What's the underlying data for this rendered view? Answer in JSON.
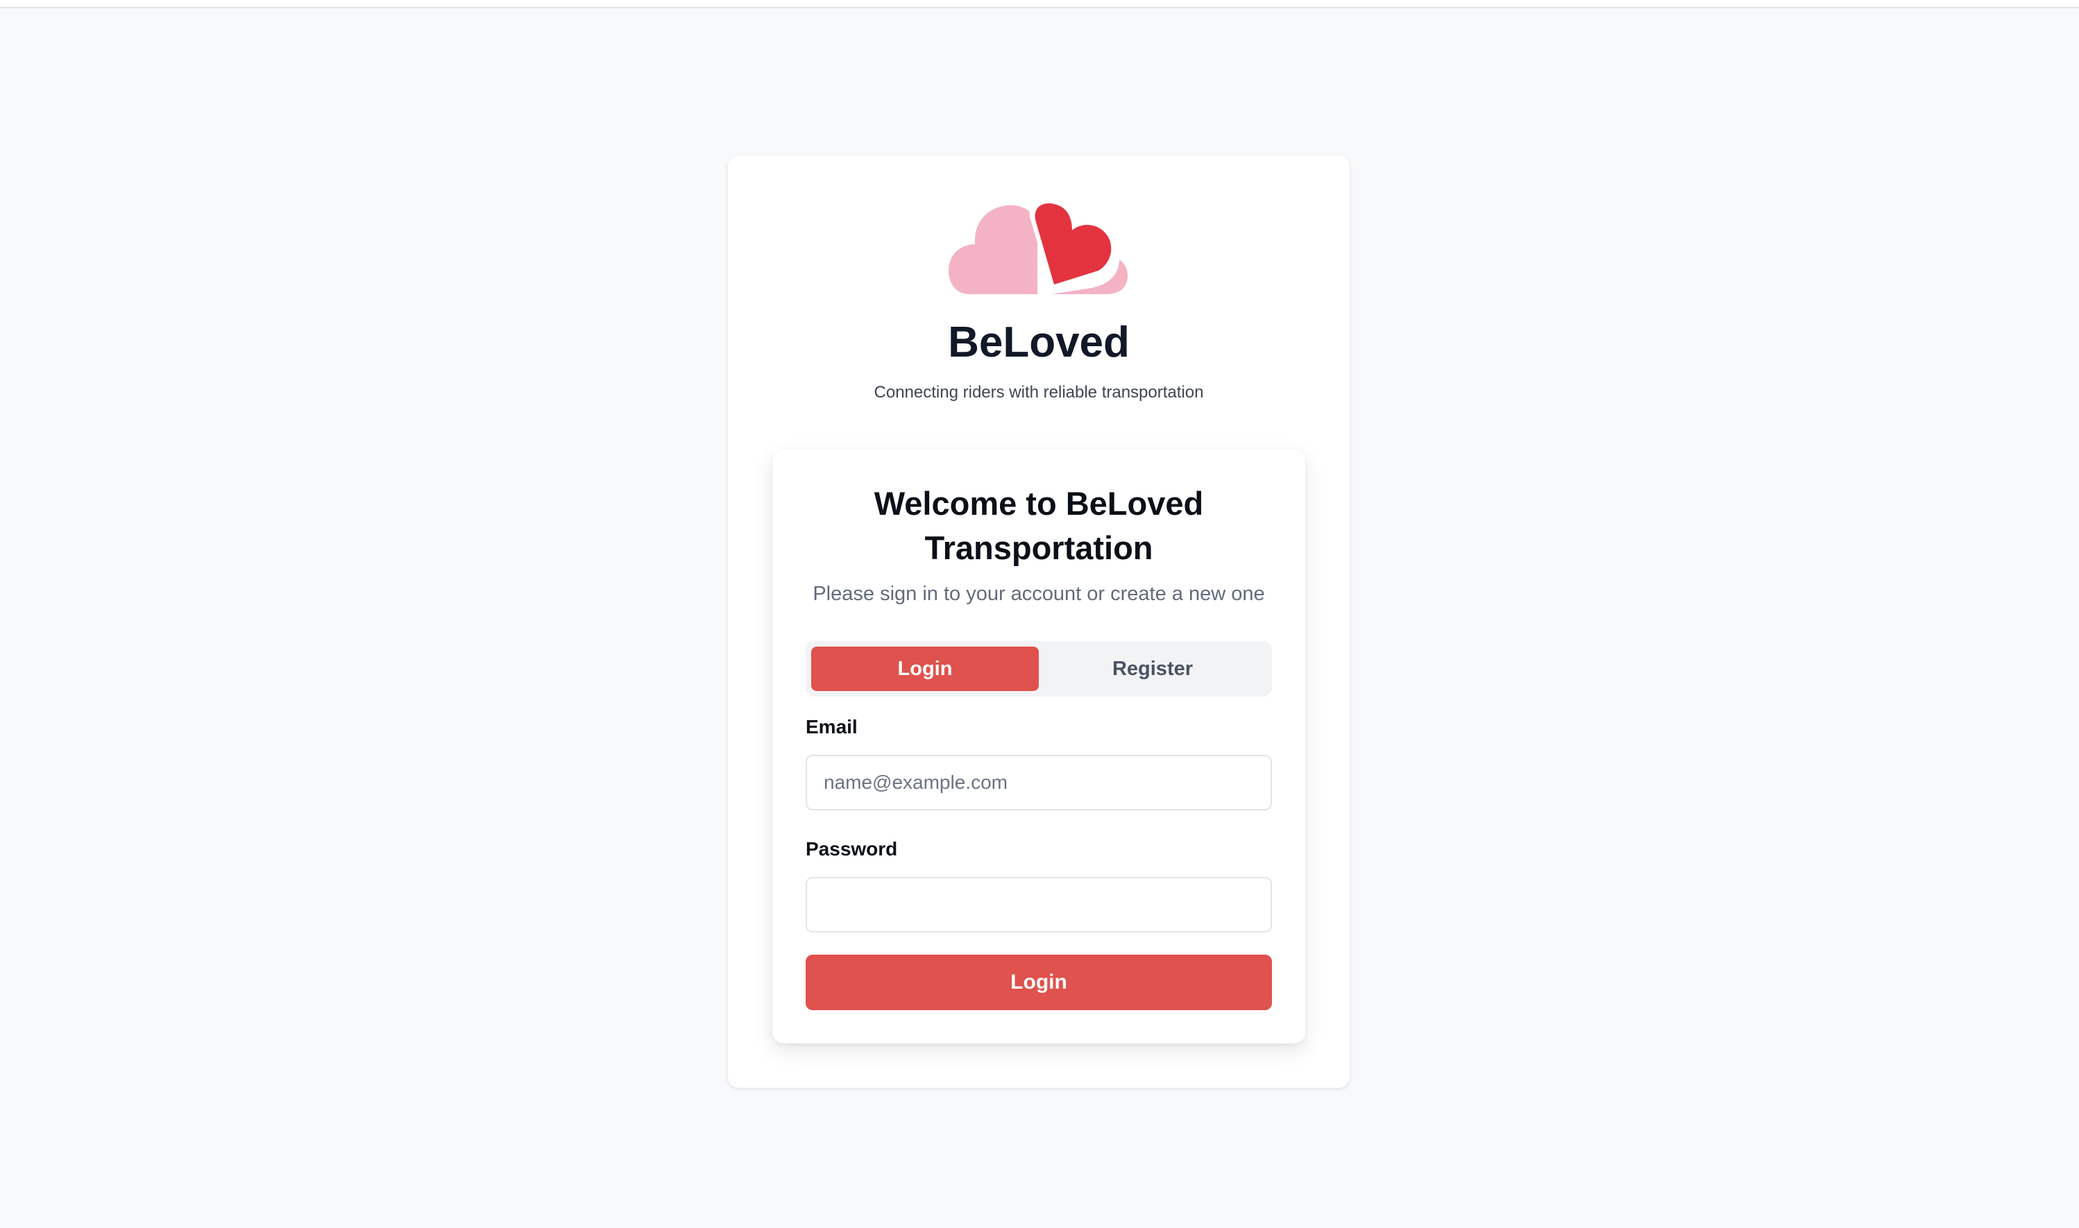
{
  "brand": {
    "name": "BeLoved",
    "tagline": "Connecting riders with reliable transportation",
    "logo_icon": "two-hearts-icon",
    "colors": {
      "light_heart": "#f4b3c4",
      "dark_heart": "#e3333f"
    }
  },
  "auth_card": {
    "title": "Welcome to BeLoved Transportation",
    "subtitle": "Please sign in to your account or create a new one",
    "tabs": [
      {
        "label": "Login",
        "active": true
      },
      {
        "label": "Register",
        "active": false
      }
    ],
    "email": {
      "label": "Email",
      "placeholder": "name@example.com",
      "value": ""
    },
    "password": {
      "label": "Password",
      "value": ""
    },
    "submit_label": "Login"
  },
  "theme": {
    "accent": "#df524d",
    "background": "#f8f9fb"
  }
}
